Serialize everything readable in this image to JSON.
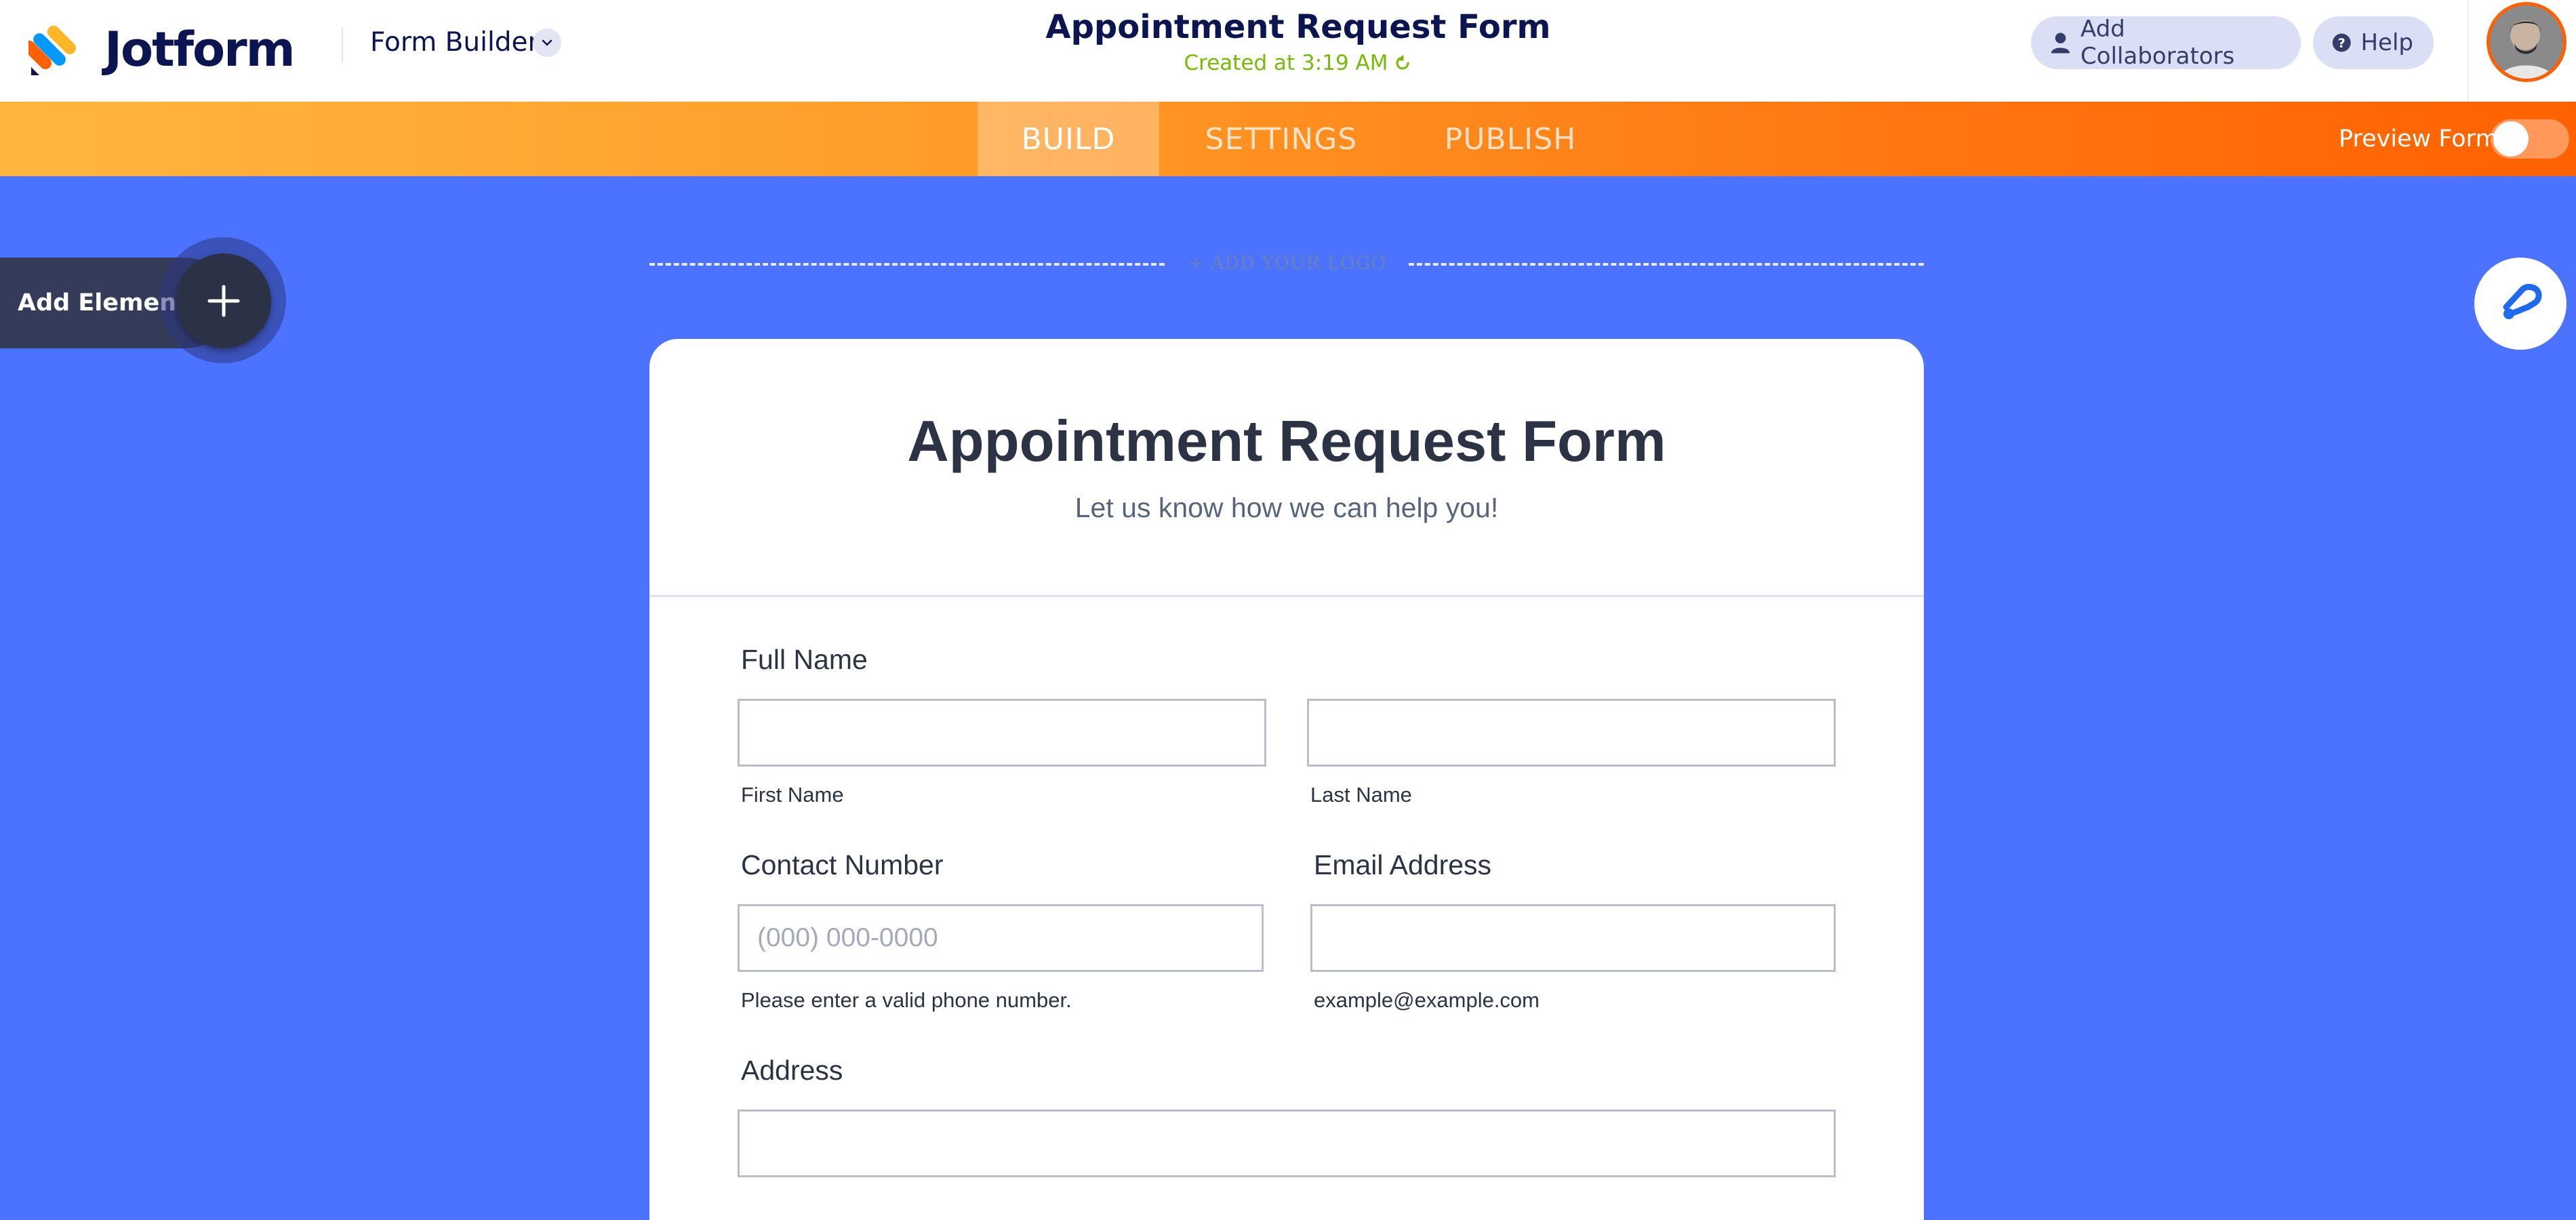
{
  "app": {
    "name": "Jotform",
    "mode_label": "Form Builder"
  },
  "header": {
    "title": "Appointment Request Form",
    "created_status": "Created at 3:19 AM",
    "add_collaborators_label": "Add Collaborators",
    "help_label": "Help"
  },
  "nav": {
    "tabs": [
      {
        "label": "BUILD",
        "active": true
      },
      {
        "label": "SETTINGS",
        "active": false
      },
      {
        "label": "PUBLISH",
        "active": false
      }
    ],
    "preview_label": "Preview Form",
    "preview_enabled": false
  },
  "canvas": {
    "add_element_label": "Add Element",
    "add_logo_label": "+ ADD YOUR LOGO"
  },
  "form": {
    "title": "Appointment Request Form",
    "subtitle": "Let us know how we can help you!",
    "full_name": {
      "label": "Full Name",
      "first_sublabel": "First Name",
      "last_sublabel": "Last Name"
    },
    "contact_number": {
      "label": "Contact Number",
      "placeholder": "(000) 000-0000",
      "hint": "Please enter a valid phone number."
    },
    "email": {
      "label": "Email Address",
      "hint": "example@example.com"
    },
    "address": {
      "label": "Address"
    }
  },
  "colors": {
    "canvas_background": "#4c73ff",
    "nav_gradient_start": "#ffb63f",
    "nav_gradient_end": "#ff6100",
    "brand_navy": "#0a1551",
    "status_green": "#78bb07"
  },
  "icons": {
    "logo": "jotform-logo-icon",
    "chevron": "chevron-down-icon",
    "collaborators": "user-icon",
    "help": "help-circle-icon",
    "refresh": "refresh-icon",
    "add": "plus-icon",
    "designer": "paint-roller-icon"
  }
}
